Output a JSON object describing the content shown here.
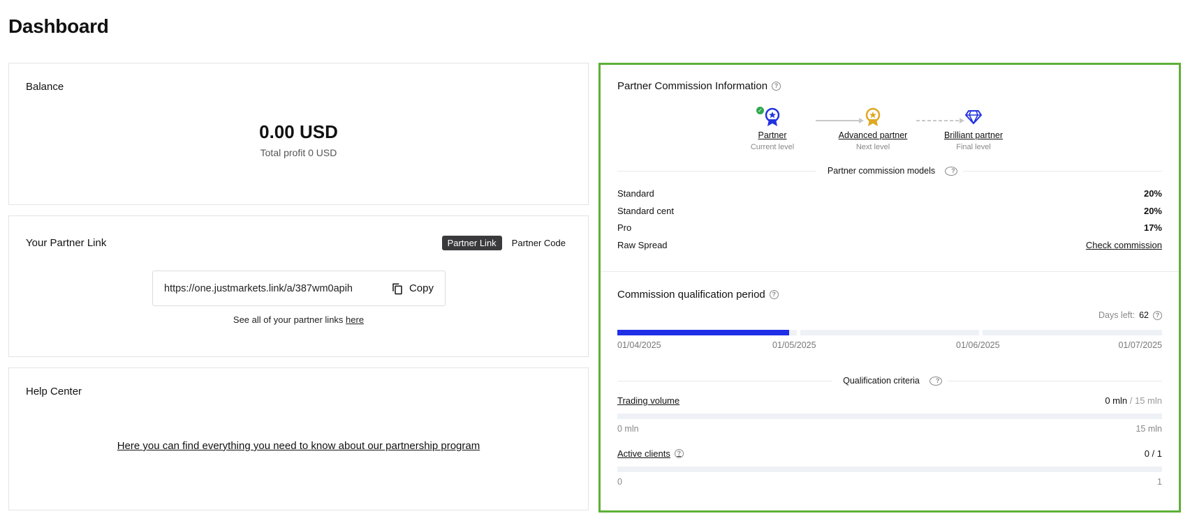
{
  "page": {
    "title": "Dashboard"
  },
  "balance": {
    "title": "Balance",
    "amount": "0.00 USD",
    "total_profit": "Total profit 0 USD"
  },
  "partner_link": {
    "title": "Your Partner Link",
    "tabs": [
      "Partner Link",
      "Partner Code"
    ],
    "active_tab": "Partner Link",
    "url": "https://one.justmarkets.link/a/387wm0apih",
    "copy_label": "Copy",
    "hint_prefix": "See all of your partner links ",
    "hint_link": "here"
  },
  "help_center": {
    "title": "Help Center",
    "link_text": "Here you can find everything you need to know about our partnership program"
  },
  "commission": {
    "title": "Partner Commission Information",
    "levels": [
      {
        "name": "Partner",
        "status": "Current level",
        "icon": "medal-blue-icon",
        "color": "#2233e0"
      },
      {
        "name": "Advanced partner",
        "status": "Next level",
        "icon": "medal-gold-icon",
        "color": "#e0a822"
      },
      {
        "name": "Brilliant partner",
        "status": "Final level",
        "icon": "diamond-icon",
        "color": "#2233e0"
      }
    ],
    "models_title": "Partner commission models",
    "models": [
      {
        "name": "Standard",
        "value": "20%"
      },
      {
        "name": "Standard cent",
        "value": "20%"
      },
      {
        "name": "Pro",
        "value": "17%"
      },
      {
        "name": "Raw Spread",
        "value": "Check commission"
      }
    ],
    "period_title": "Commission qualification period",
    "days_left_label": "Days left:",
    "days_left": "62",
    "period_progress": 0.32,
    "period_dates": [
      "01/04/2025",
      "01/05/2025",
      "01/06/2025",
      "01/07/2025"
    ],
    "criteria_title": "Qualification criteria",
    "criteria": [
      {
        "name": "Trading volume",
        "current": "0 mln",
        "target": "/ 15 mln",
        "min": "0 mln",
        "max": "15 mln",
        "progress": 0
      },
      {
        "name": "Active clients",
        "current": "0 / 1",
        "target": "",
        "min": "0",
        "max": "1",
        "progress": 0
      }
    ]
  },
  "colors": {
    "accent": "#1f2fe6",
    "highlight_border": "#5db037",
    "success": "#2fa84f"
  }
}
